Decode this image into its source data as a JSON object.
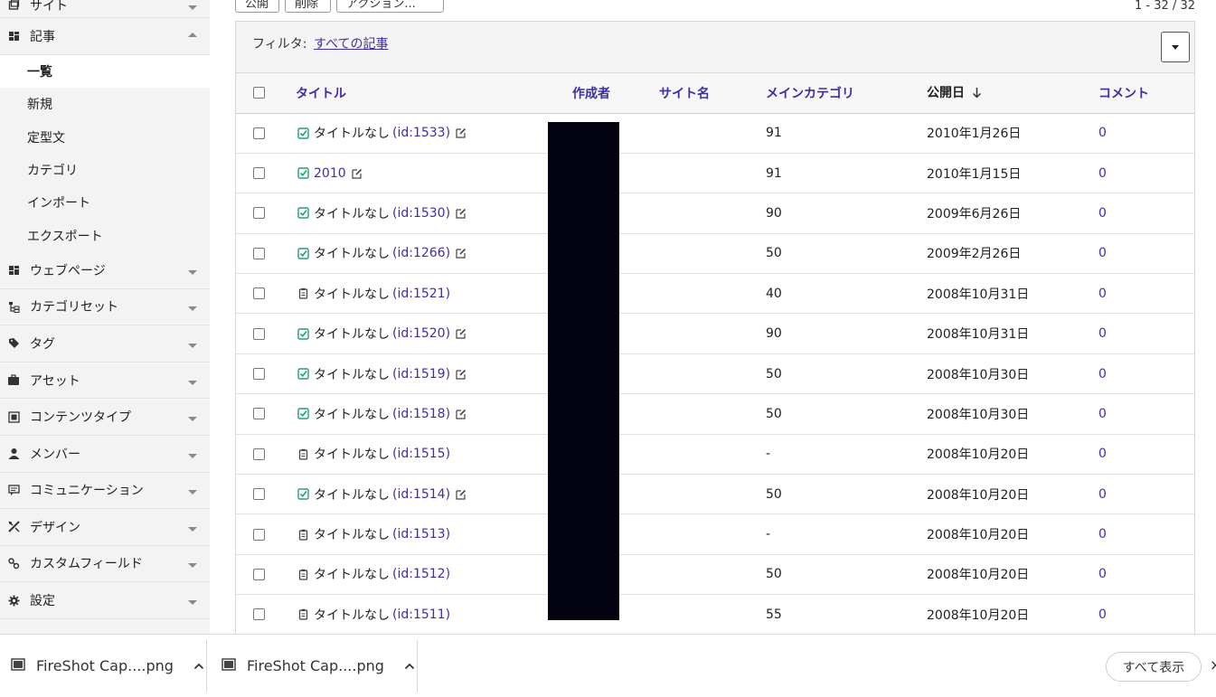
{
  "sidebar": {
    "top_item": {
      "label": "サイト",
      "icon": "site-icon"
    },
    "entries": {
      "label": "記事",
      "icon": "entries-icon",
      "sub": [
        "一覧",
        "新規",
        "定型文",
        "カテゴリ",
        "インポート",
        "エクスポート"
      ],
      "active_index": 0
    },
    "items": [
      {
        "label": "ウェブページ",
        "icon": "webpage-icon"
      },
      {
        "label": "カテゴリセット",
        "icon": "category-set-icon"
      },
      {
        "label": "タグ",
        "icon": "tag-icon"
      },
      {
        "label": "アセット",
        "icon": "asset-icon"
      },
      {
        "label": "コンテンツタイプ",
        "icon": "content-type-icon"
      },
      {
        "label": "メンバー",
        "icon": "member-icon"
      },
      {
        "label": "コミュニケーション",
        "icon": "communication-icon"
      },
      {
        "label": "デザイン",
        "icon": "design-icon"
      },
      {
        "label": "カスタムフィールド",
        "icon": "custom-field-icon"
      },
      {
        "label": "設定",
        "icon": "settings-icon"
      }
    ]
  },
  "toolbar": {
    "publish_label": "公開",
    "delete_label": "削除",
    "actions_label": "アクション...",
    "count": "1 - 32 / 32"
  },
  "filter": {
    "label": "フィルタ:",
    "value": "すべての記事"
  },
  "table": {
    "headers": {
      "title": "タイトル",
      "author": "作成者",
      "site": "サイト名",
      "category": "メインカテゴリ",
      "date": "公開日",
      "comments": "コメント"
    },
    "rows": [
      {
        "status": "published",
        "text": "タイトルなし",
        "id": "(id:1533)",
        "edit": true,
        "category": "91",
        "date": "2010年1月26日",
        "comments": "0"
      },
      {
        "status": "published",
        "text": "",
        "id": "2010",
        "edit": true,
        "category": "91",
        "date": "2010年1月15日",
        "comments": "0"
      },
      {
        "status": "published",
        "text": "タイトルなし",
        "id": "(id:1530)",
        "edit": true,
        "category": "90",
        "date": "2009年6月26日",
        "comments": "0"
      },
      {
        "status": "published",
        "text": "タイトルなし",
        "id": "(id:1266)",
        "edit": true,
        "category": "50",
        "date": "2009年2月26日",
        "comments": "0"
      },
      {
        "status": "draft",
        "text": "タイトルなし",
        "id": "(id:1521)",
        "edit": false,
        "category": "40",
        "date": "2008年10月31日",
        "comments": "0"
      },
      {
        "status": "published",
        "text": "タイトルなし",
        "id": "(id:1520)",
        "edit": true,
        "category": "90",
        "date": "2008年10月31日",
        "comments": "0"
      },
      {
        "status": "published",
        "text": "タイトルなし",
        "id": "(id:1519)",
        "edit": true,
        "category": "50",
        "date": "2008年10月30日",
        "comments": "0"
      },
      {
        "status": "published",
        "text": "タイトルなし",
        "id": "(id:1518)",
        "edit": true,
        "category": "50",
        "date": "2008年10月30日",
        "comments": "0"
      },
      {
        "status": "draft",
        "text": "タイトルなし",
        "id": "(id:1515)",
        "edit": false,
        "category": "-",
        "date": "2008年10月20日",
        "comments": "0"
      },
      {
        "status": "published",
        "text": "タイトルなし",
        "id": "(id:1514)",
        "edit": true,
        "category": "50",
        "date": "2008年10月20日",
        "comments": "0"
      },
      {
        "status": "draft",
        "text": "タイトルなし",
        "id": "(id:1513)",
        "edit": false,
        "category": "-",
        "date": "2008年10月20日",
        "comments": "0"
      },
      {
        "status": "draft",
        "text": "タイトルなし",
        "id": "(id:1512)",
        "edit": false,
        "category": "50",
        "date": "2008年10月20日",
        "comments": "0"
      },
      {
        "status": "draft",
        "text": "タイトルなし",
        "id": "(id:1511)",
        "edit": false,
        "category": "55",
        "date": "2008年10月20日",
        "comments": "0"
      }
    ]
  },
  "downloads": {
    "items": [
      {
        "name": "FireShot Cap....png"
      },
      {
        "name": "FireShot Cap....png"
      }
    ],
    "show_all": "すべて表示",
    "close": "×"
  },
  "colors": {
    "link": "#3b2fa8",
    "published": "#2a9d6f",
    "redaction": "#020210"
  }
}
